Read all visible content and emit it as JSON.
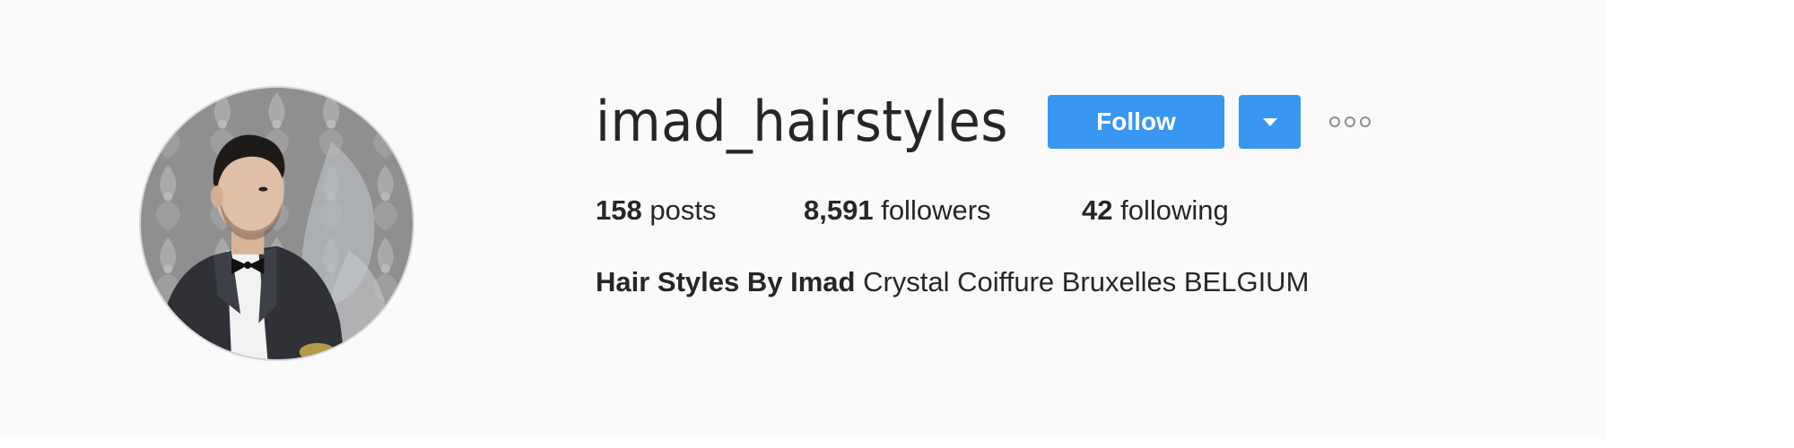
{
  "profile": {
    "username": "imad_hairstyles",
    "avatar_alt": "profile photo",
    "follow_label": "Follow",
    "dropdown_icon": "caret-down-icon",
    "options_icon": "more-options-icon",
    "stats": {
      "posts_count": "158",
      "posts_label": "posts",
      "followers_count": "8,591",
      "followers_label": "followers",
      "following_count": "42",
      "following_label": "following"
    },
    "bio": {
      "full_name": "Hair Styles By Imad",
      "text": "Crystal Coiffure Bruxelles BELGIUM"
    }
  },
  "colors": {
    "accent": "#3897f0",
    "text": "#262626",
    "panel_background": "#fafafa",
    "page_background": "#ffffff",
    "muted": "#8e8e8e"
  }
}
